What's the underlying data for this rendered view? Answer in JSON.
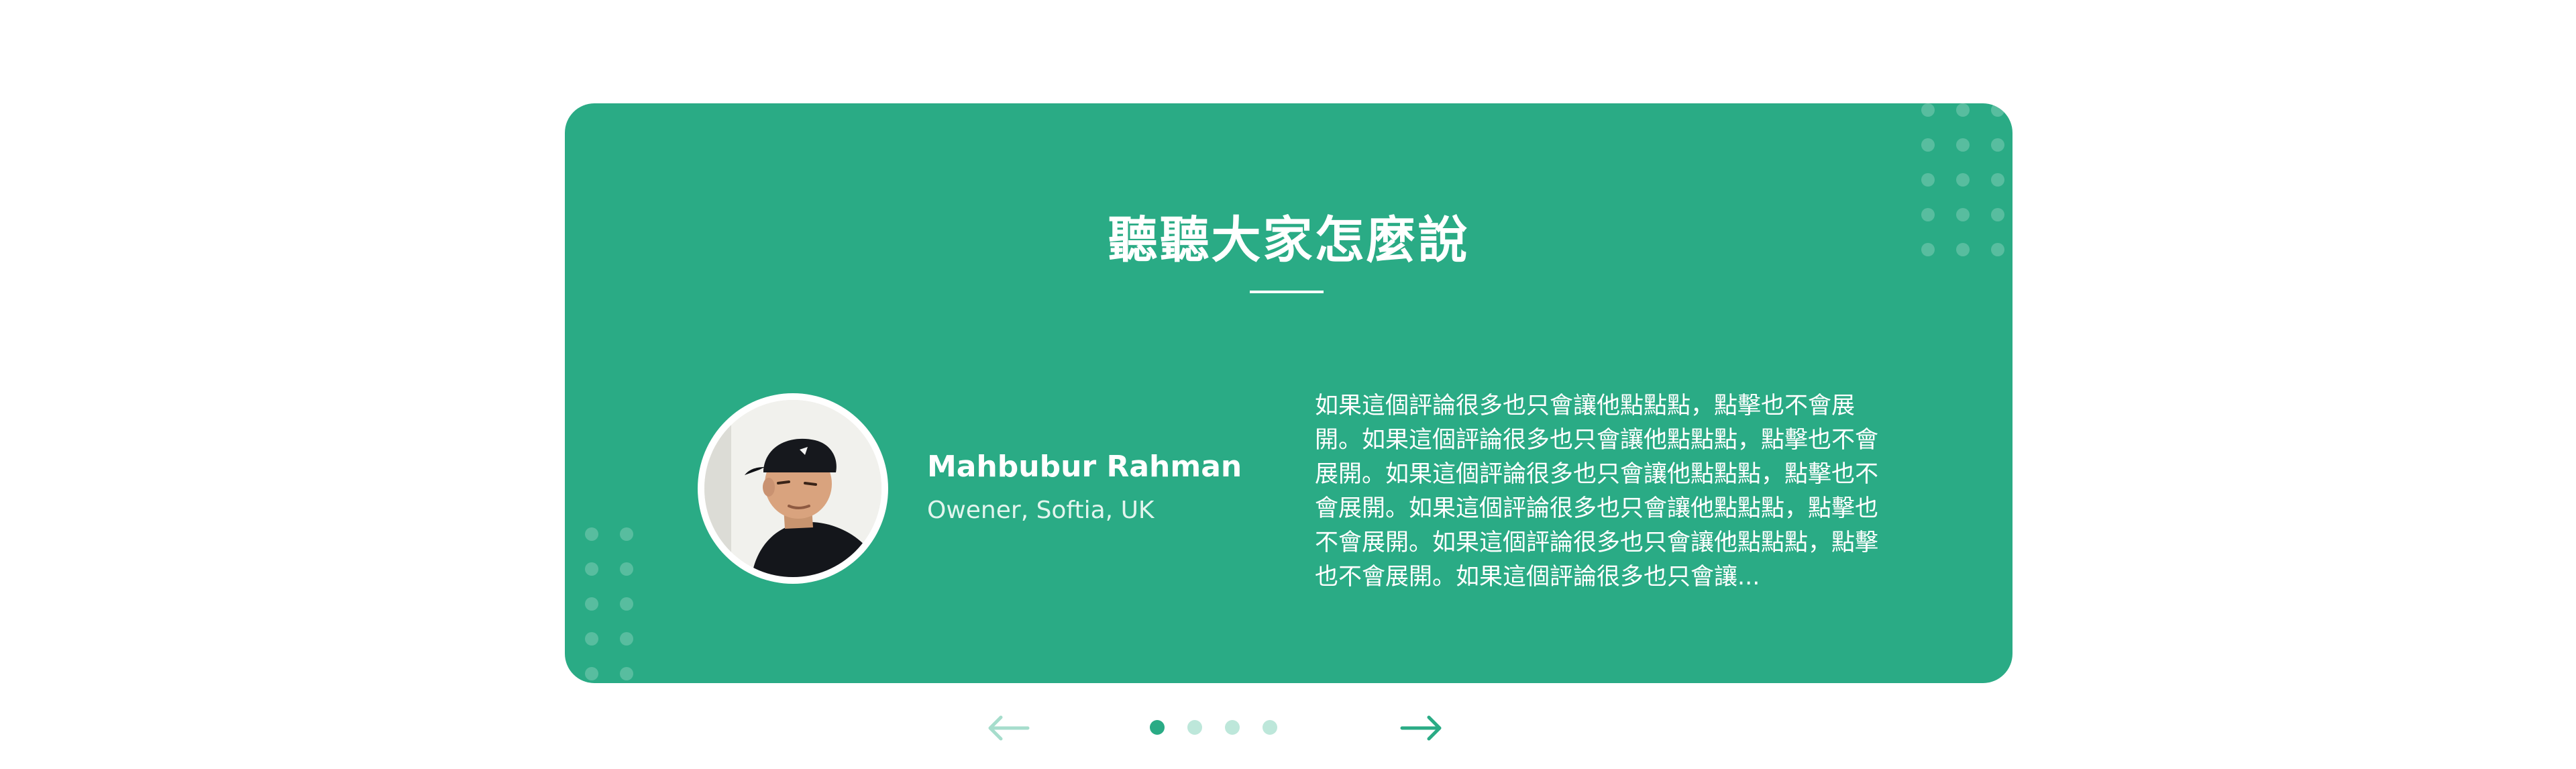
{
  "testimonials": {
    "title": "聽聽大家怎麼說",
    "author": {
      "name": "Mahbubur Rahman",
      "role": "Owener, Softia, UK"
    },
    "review": "如果這個評論很多也只會讓他點點點，點擊也不會展開。如果這個評論很多也只會讓他點點點，點擊也不會展開。如果這個評論很多也只會讓他點點點，點擊也不會展開。如果這個評論很多也只會讓他點點點，點擊也不會展開。如果這個評論很多也只會讓他點點點，點擊也不會展開。如果這個評論很多也只會讓...",
    "pager": {
      "count": 4,
      "active_index": 0
    },
    "icons": {
      "prev": "arrow-left-icon",
      "next": "arrow-right-icon"
    }
  },
  "colors": {
    "card": "#2aab85",
    "accent": "#2aab85",
    "inactive_dot": "#bde7da",
    "text": "#ffffff"
  }
}
